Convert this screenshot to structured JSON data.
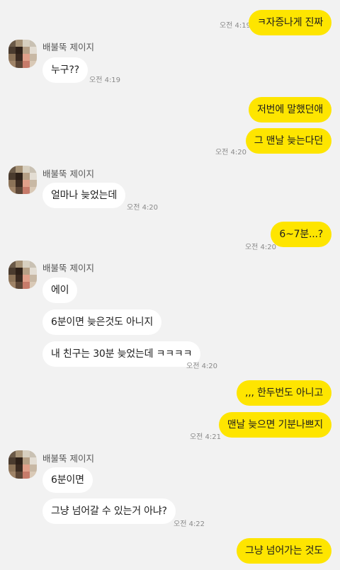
{
  "colors": {
    "background": "#f2f2f2",
    "my_bubble": "#fee500",
    "their_bubble": "#ffffff"
  },
  "sender": {
    "name": "배불뚝 제이지",
    "avatar_icon": "pixelated-profile-avatar-icon"
  },
  "messages": {
    "m1": {
      "text": "ㅋ자증나게 진짜",
      "time": "오전 4:19"
    },
    "m2": {
      "text": "누구??",
      "time": "오전 4:19"
    },
    "m3": {
      "text": "저번에 말했던애"
    },
    "m4": {
      "text": "그 맨날 늦는다던",
      "time": "오전 4:20"
    },
    "m5": {
      "text": "얼마나 늦었는데",
      "time": "오전 4:20"
    },
    "m6": {
      "text": "6~7분...?",
      "time": "오전 4:20"
    },
    "m7": {
      "text": "에이"
    },
    "m8": {
      "text": "6분이면 늦은것도 아니지"
    },
    "m9": {
      "text": "내 친구는 30분 늦었는데 ㅋㅋㅋㅋ",
      "time": "오전 4:20"
    },
    "m10": {
      "text": ",,, 한두번도 아니고"
    },
    "m11": {
      "text": "맨날 늦으면 기분나쁘지",
      "time": "오전 4:21"
    },
    "m12": {
      "text": "6분이면"
    },
    "m13": {
      "text": "그냥 넘어갈 수 있는거 아냐?",
      "time": "오전 4:22"
    },
    "m14": {
      "text": "그냥 넘어가는 것도"
    }
  }
}
